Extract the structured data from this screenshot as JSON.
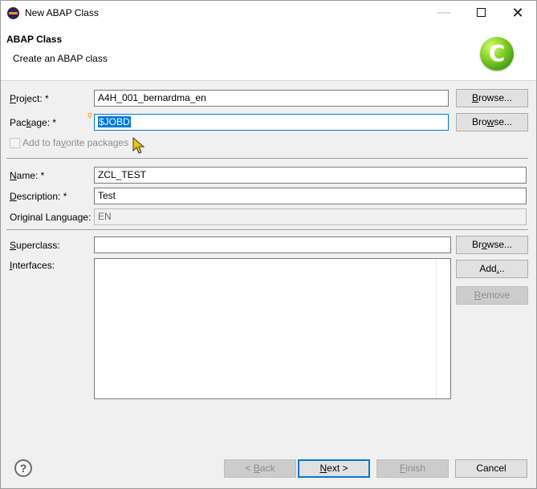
{
  "window": {
    "title": "New ABAP Class",
    "minimize": "—",
    "close": "✕"
  },
  "banner": {
    "title": "ABAP Class",
    "subtitle": "Create an ABAP class",
    "logo_letter": "C",
    "logo_color": "#6cc51d"
  },
  "form": {
    "project": {
      "label_key": "P",
      "label_rest": "roject: *",
      "value": "A4H_001_bernardma_en"
    },
    "package": {
      "label_pre": "Pac",
      "label_key": "k",
      "label_rest": "age: *",
      "value": "$JOBD"
    },
    "favorite": {
      "label_pre": "Add to fa",
      "label_key": "v",
      "label_rest": "orite packages",
      "checked": false
    },
    "name": {
      "label_key": "N",
      "label_rest": "ame: *",
      "value": "ZCL_TEST"
    },
    "description": {
      "label_key": "D",
      "label_rest": "escription: *",
      "value": "Test"
    },
    "original_language": {
      "label": "Original Language:",
      "value": "EN"
    },
    "superclass": {
      "label_key": "S",
      "label_rest": "uperclass:",
      "value": ""
    },
    "interfaces": {
      "label_key": "I",
      "label_rest": "nterfaces:"
    }
  },
  "buttons": {
    "browse_project": {
      "pre": "",
      "key": "B",
      "rest": "rowse..."
    },
    "browse_package": {
      "pre": "Bro",
      "key": "w",
      "rest": "se..."
    },
    "browse_superclass": {
      "pre": "Br",
      "key": "o",
      "rest": "wse..."
    },
    "add": {
      "pre": "Add",
      "key": ".",
      "rest": ".."
    },
    "remove": {
      "pre": "",
      "key": "R",
      "rest": "emove"
    },
    "back": {
      "pre": "< ",
      "key": "B",
      "rest": "ack"
    },
    "next": {
      "pre": "",
      "key": "N",
      "rest": "ext >"
    },
    "finish": {
      "pre": "",
      "key": "F",
      "rest": "inish"
    },
    "cancel": {
      "label": "Cancel"
    }
  },
  "help": {
    "glyph": "?"
  },
  "colors": {
    "accent": "#0078d7",
    "selection": "#0078d7"
  }
}
